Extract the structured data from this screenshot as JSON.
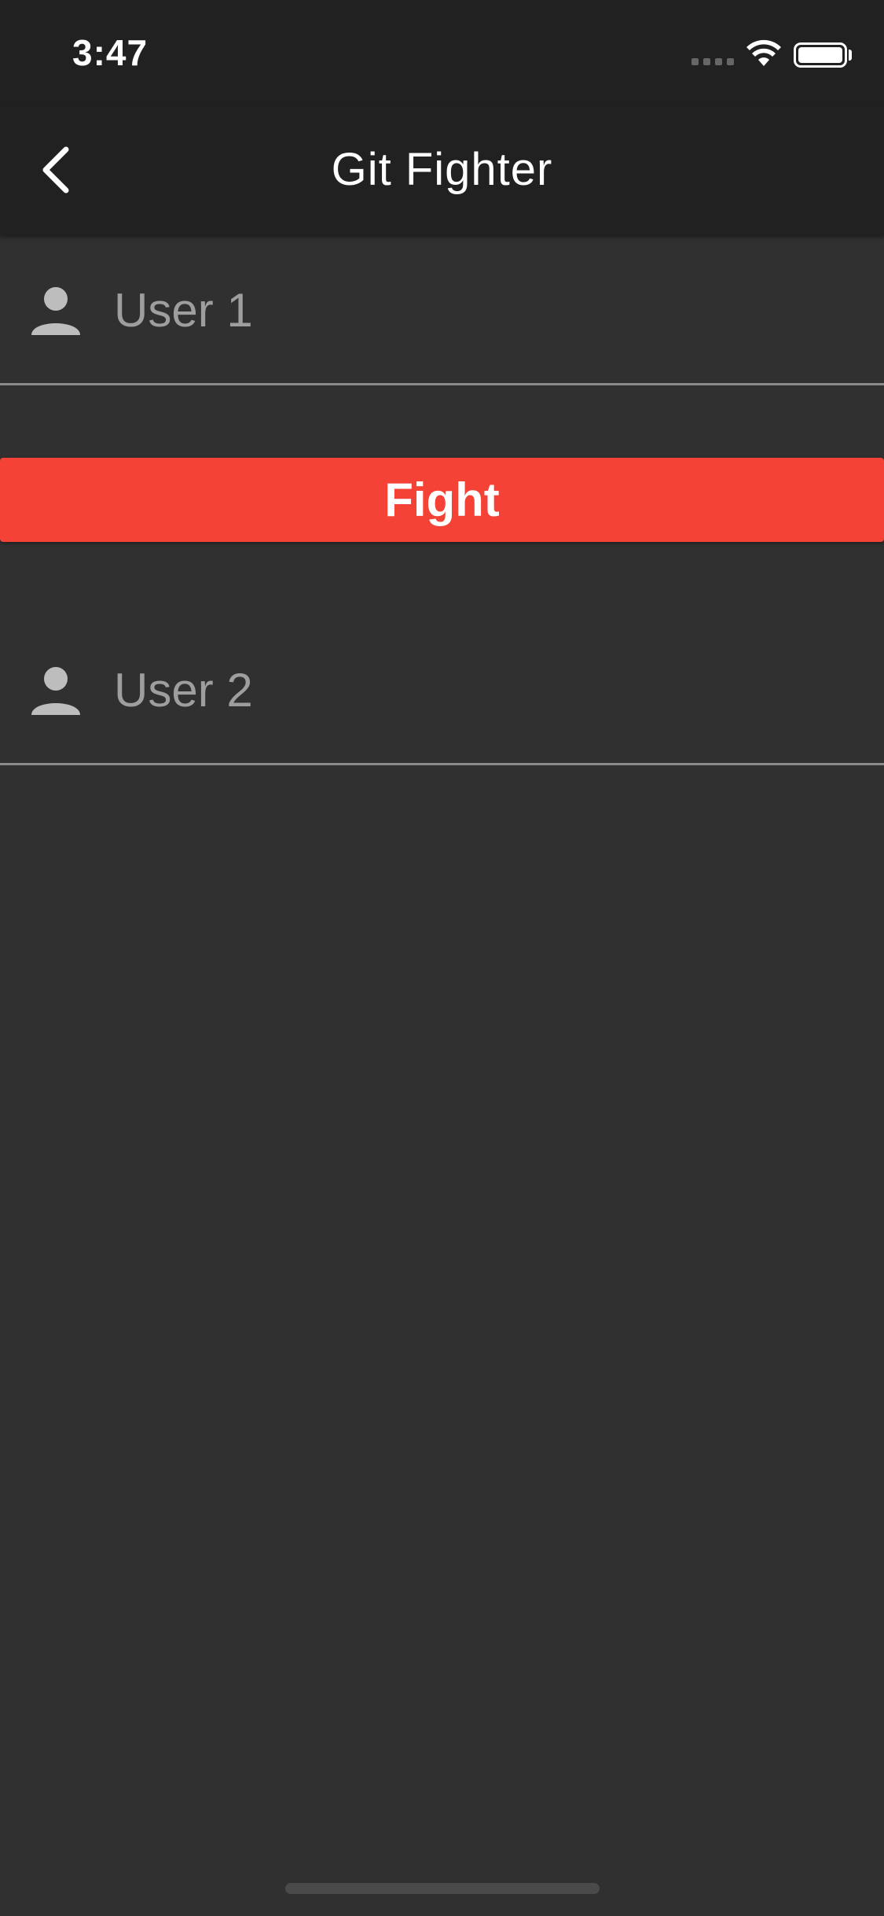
{
  "status_bar": {
    "time": "3:47",
    "icons": [
      "cellular-signal-icon",
      "wifi-icon",
      "battery-icon"
    ]
  },
  "app_bar": {
    "title": "Git Fighter",
    "back_icon": "chevron-left-icon"
  },
  "form": {
    "user1": {
      "placeholder": "User 1",
      "value": "",
      "icon": "person-icon"
    },
    "fight_button": {
      "label": "Fight"
    },
    "user2": {
      "placeholder": "User 2",
      "value": "",
      "icon": "person-icon"
    }
  },
  "colors": {
    "background": "#303030",
    "app_bar": "#212121",
    "accent": "#f44336",
    "placeholder_text": "#9e9e9e",
    "underline": "#8a8a8a"
  }
}
